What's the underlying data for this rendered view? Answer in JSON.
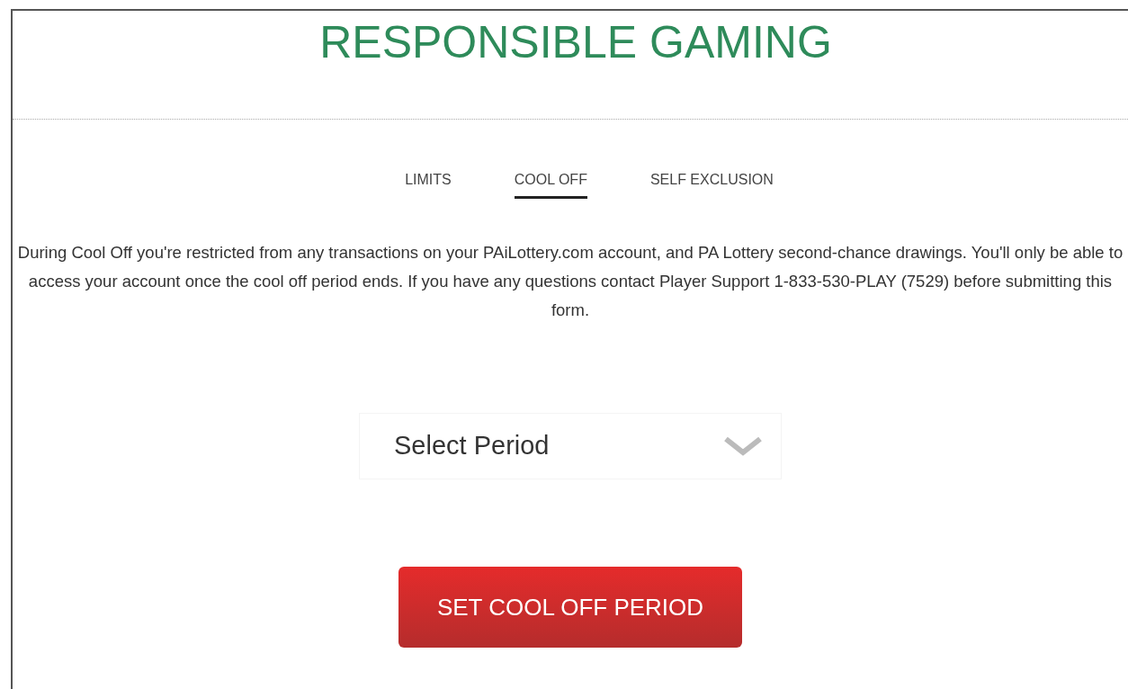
{
  "title": "RESPONSIBLE GAMING",
  "tabs": [
    {
      "label": "LIMITS",
      "selected": false
    },
    {
      "label": "COOL OFF",
      "selected": true
    },
    {
      "label": "SELF EXCLUSION",
      "selected": false
    }
  ],
  "description": "During Cool Off you're restricted from any transactions on your PAiLottery.com account, and PA Lottery second-chance drawings. You'll only be able to access your account once the cool off period ends. If you have any questions contact Player Support 1-833-530-PLAY (7529) before submitting this form.",
  "period_select": {
    "placeholder": "Select Period"
  },
  "submit_button": "SET COOL OFF PERIOD"
}
